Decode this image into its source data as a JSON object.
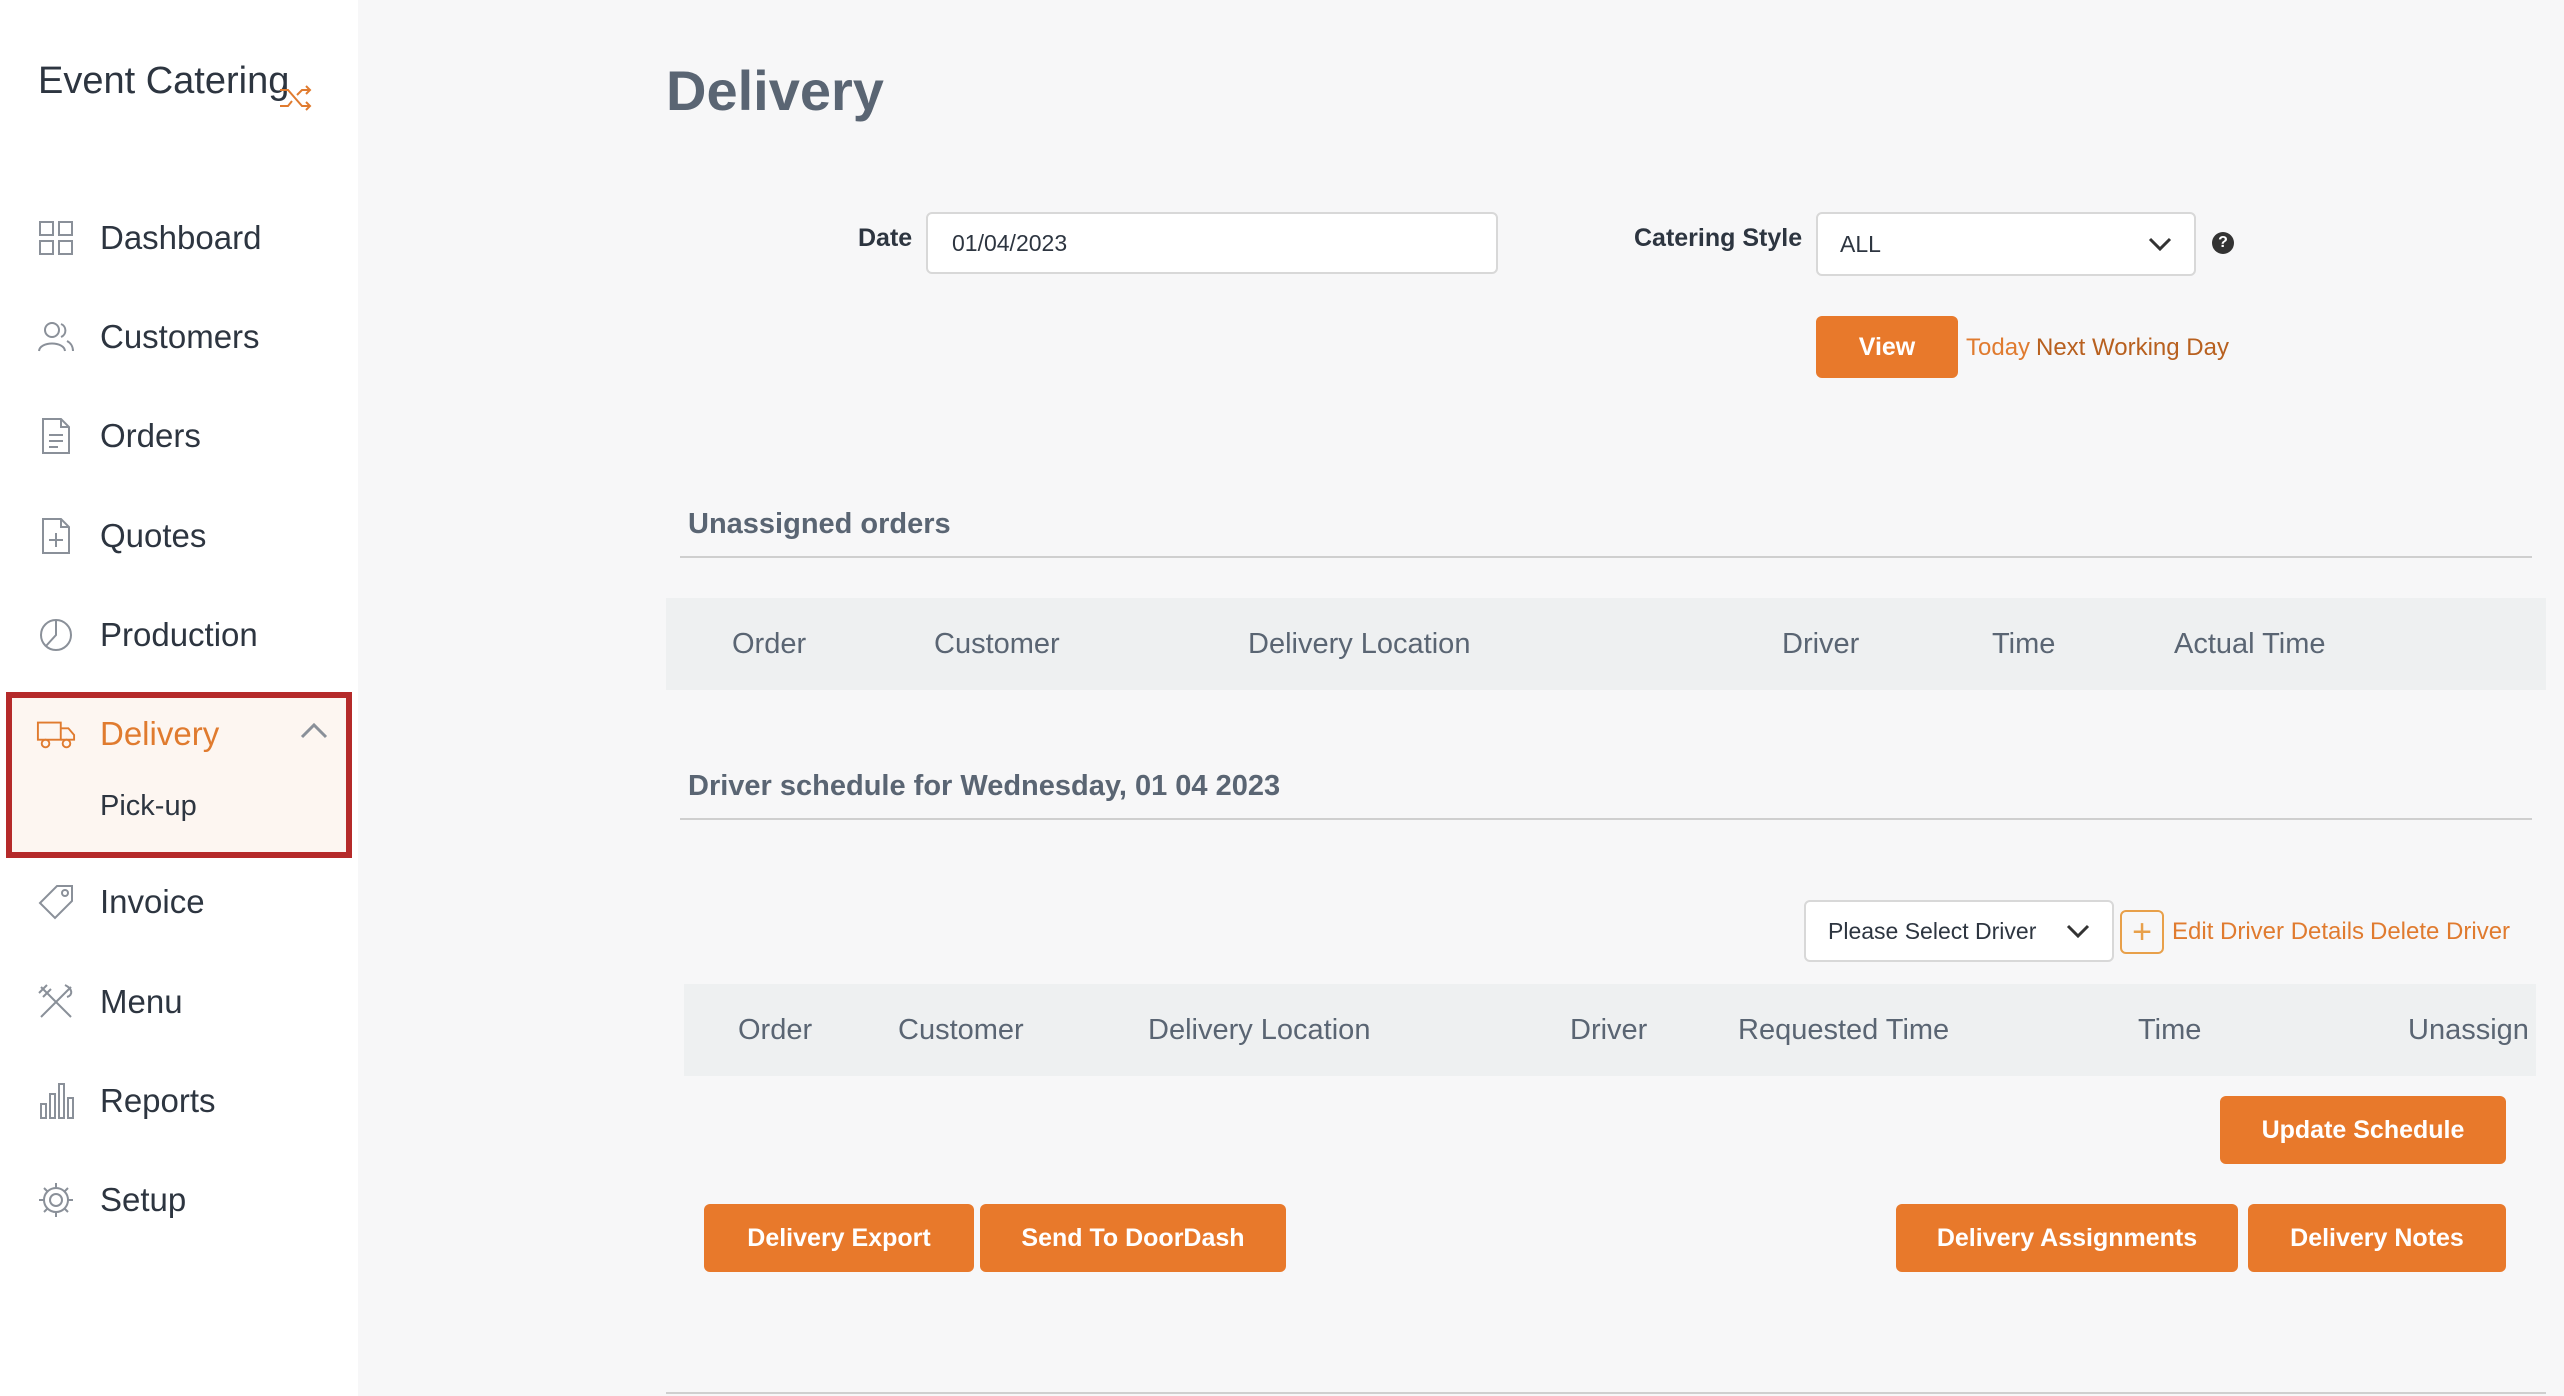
{
  "app": {
    "brand": "Event Catering"
  },
  "sidebar": {
    "items": [
      {
        "label": "Dashboard",
        "icon": "dashboard-grid-icon"
      },
      {
        "label": "Customers",
        "icon": "users-icon"
      },
      {
        "label": "Orders",
        "icon": "document-icon"
      },
      {
        "label": "Quotes",
        "icon": "document-plus-icon"
      },
      {
        "label": "Production",
        "icon": "pie-chart-icon"
      },
      {
        "label": "Delivery",
        "icon": "truck-icon",
        "active": true
      },
      {
        "label": "Invoice",
        "icon": "tag-icon"
      },
      {
        "label": "Menu",
        "icon": "utensils-icon"
      },
      {
        "label": "Reports",
        "icon": "bar-chart-icon"
      },
      {
        "label": "Setup",
        "icon": "gear-icon"
      }
    ],
    "delivery_sub": "Pick-up"
  },
  "page": {
    "title": "Delivery"
  },
  "filters": {
    "date_label": "Date",
    "date_value": "01/04/2023",
    "style_label": "Catering Style",
    "style_value": "ALL",
    "view_button": "View",
    "today_link": "Today",
    "next_day_link": "Next Working Day"
  },
  "unassigned": {
    "title": "Unassigned orders",
    "columns": [
      "Order",
      "Customer",
      "Delivery Location",
      "Driver",
      "Time",
      "Actual Time"
    ]
  },
  "schedule": {
    "title": "Driver schedule for Wednesday, 01 04 2023",
    "driver_select": "Please Select Driver",
    "edit_link": "Edit Driver Details",
    "delete_link": "Delete Driver",
    "columns": [
      "Order",
      "Customer",
      "Delivery Location",
      "Driver",
      "Requested Time",
      "Time",
      "Unassign"
    ],
    "update_button": "Update Schedule"
  },
  "actions": {
    "export": "Delivery Export",
    "doordash": "Send To DoorDash",
    "assignments": "Delivery Assignments",
    "notes": "Delivery Notes"
  },
  "colors": {
    "accent": "#e8792b",
    "highlight_border": "#b52a2a"
  }
}
